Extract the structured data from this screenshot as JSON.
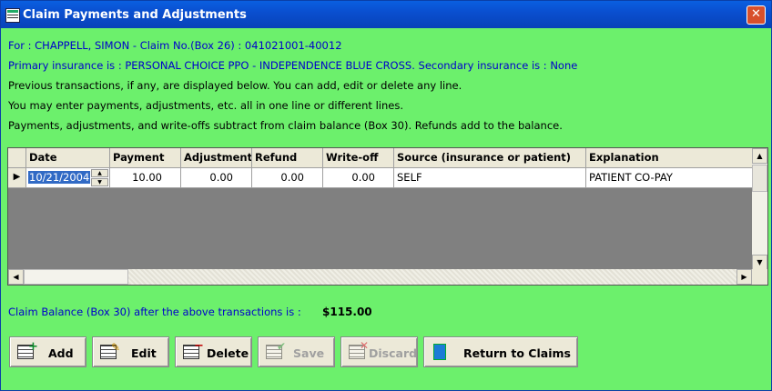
{
  "window": {
    "title": "Claim Payments and Adjustments",
    "close_glyph": "✕"
  },
  "info": {
    "line1": "For : CHAPPELL, SIMON - Claim No.(Box 26) : 041021001-40012",
    "line2": "Primary insurance is : PERSONAL CHOICE PPO - INDEPENDENCE BLUE CROSS.  Secondary insurance is : None",
    "line3": "Previous transactions, if any, are displayed below. You can add, edit or delete any line.",
    "line4": "You may enter payments, adjustments, etc. all in one line or different lines.",
    "line5": "Payments, adjustments, and write-offs subtract from claim balance (Box 30). Refunds add to the balance."
  },
  "grid": {
    "columns": [
      "Date",
      "Payment",
      "Adjustment",
      "Refund",
      "Write-off",
      "Source (insurance or patient)",
      "Explanation"
    ],
    "rows": [
      {
        "indicator": "▶",
        "date": "10/21/2004",
        "payment": "10.00",
        "adjustment": "0.00",
        "refund": "0.00",
        "writeoff": "0.00",
        "source": "SELF",
        "explanation": "PATIENT CO-PAY"
      }
    ]
  },
  "balance": {
    "label": "Claim Balance (Box 30) after the above transactions is :",
    "value": "$115.00"
  },
  "buttons": {
    "add": "Add",
    "edit": "Edit",
    "delete": "Delete",
    "save": "Save",
    "discard": "Discard",
    "return": "Return to Claims"
  },
  "colors": {
    "background": "#6cf06c",
    "title_bar": "#0a4fd0",
    "info_text": "#0000cc",
    "grid_empty": "#808080"
  },
  "icons": [
    "window-icon",
    "close-icon",
    "add-icon",
    "edit-icon",
    "delete-icon",
    "save-icon",
    "discard-icon",
    "return-icon"
  ]
}
